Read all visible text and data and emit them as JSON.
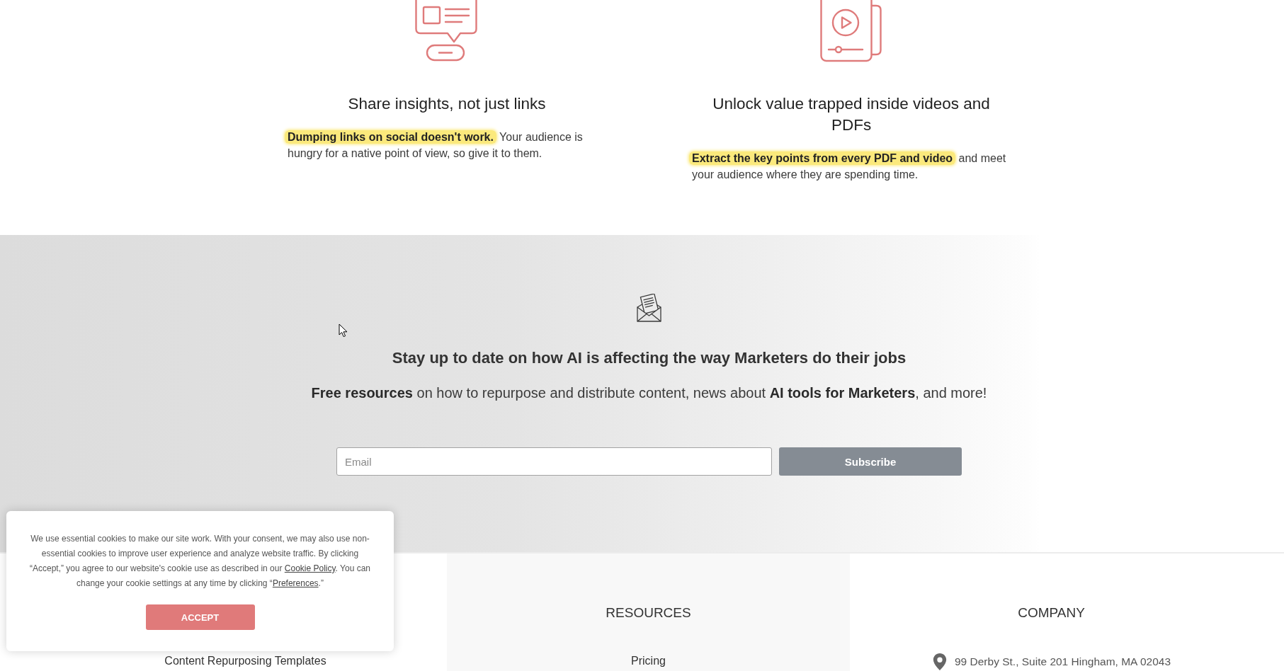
{
  "features": [
    {
      "title": "Share insights, not just links",
      "text": "**Dumping links on social doesn't work.** Your audience is hungry for a native point of view, so give it to them."
    },
    {
      "title": "Unlock value trapped inside videos and PDFs",
      "text": "**Extract the key points from every PDF and video** and meet your audience where they are spending time."
    }
  ],
  "newsletter": {
    "title": "Stay up to date on how AI is affecting the way Marketers do their jobs",
    "subtitle": "**Free resources** on how to repurpose and distribute content, news about **AI tools for Marketers**, and more!",
    "email_field": {
      "placeholder": "Email"
    },
    "subscribe_button": "Subscribe"
  },
  "footer": {
    "columns": [
      {
        "links": [
          "Content Repurposing Templates"
        ]
      },
      {
        "heading": "RESOURCES",
        "links": [
          "Pricing"
        ]
      },
      {
        "heading": "COMPANY",
        "address": "99 Derby St., Suite 201 Hingham, MA 02043"
      }
    ]
  },
  "cookie_banner": {
    "segments": [
      {
        "kind": "text",
        "text": "We use essential cookies to make our site work. With your consent, we may also use non-essential cookies to improve user experience and analyze website traffic. By clicking “Accept,” you agree to our website's cookie use as described in our "
      },
      {
        "kind": "link",
        "text": "Cookie Policy"
      },
      {
        "kind": "text",
        "text": ". You can change your cookie settings at any time by clicking “"
      },
      {
        "kind": "link",
        "text": "Preferences"
      },
      {
        "kind": "text",
        "text": ".”"
      }
    ],
    "button": "ACCEPT"
  }
}
